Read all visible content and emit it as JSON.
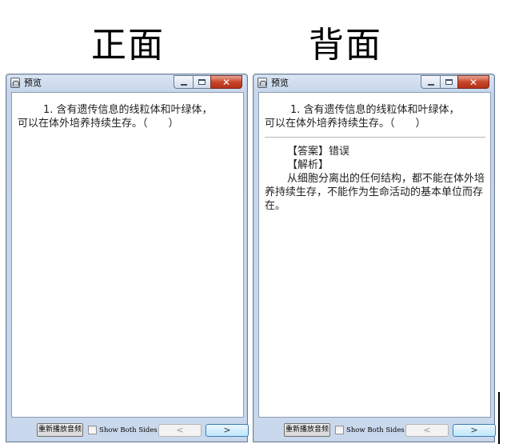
{
  "headings": {
    "front": "正面",
    "back": "背面"
  },
  "windows": {
    "front": {
      "title": "预览"
    },
    "back": {
      "title": "预览"
    }
  },
  "caption_buttons": {
    "minimize": "—",
    "maximize": "□",
    "close": "✕"
  },
  "card": {
    "question_line1": "1. 含有遗传信息的线粒体和叶绿体，",
    "question_line2": "可以在体外培养持续生存。（　　）",
    "answer_label": "【答案】错误",
    "analysis_label": "【解析】",
    "analysis_text": "从细胞分离出的任何结构，都不能在体外培养持续生存，不能作为生命活动的基本单位而存在。"
  },
  "footer": {
    "replay_label": "重新播放音频",
    "show_both_label": "Show Both Sides",
    "show_both_checked": false,
    "prev_label": "<",
    "next_label": ">"
  }
}
